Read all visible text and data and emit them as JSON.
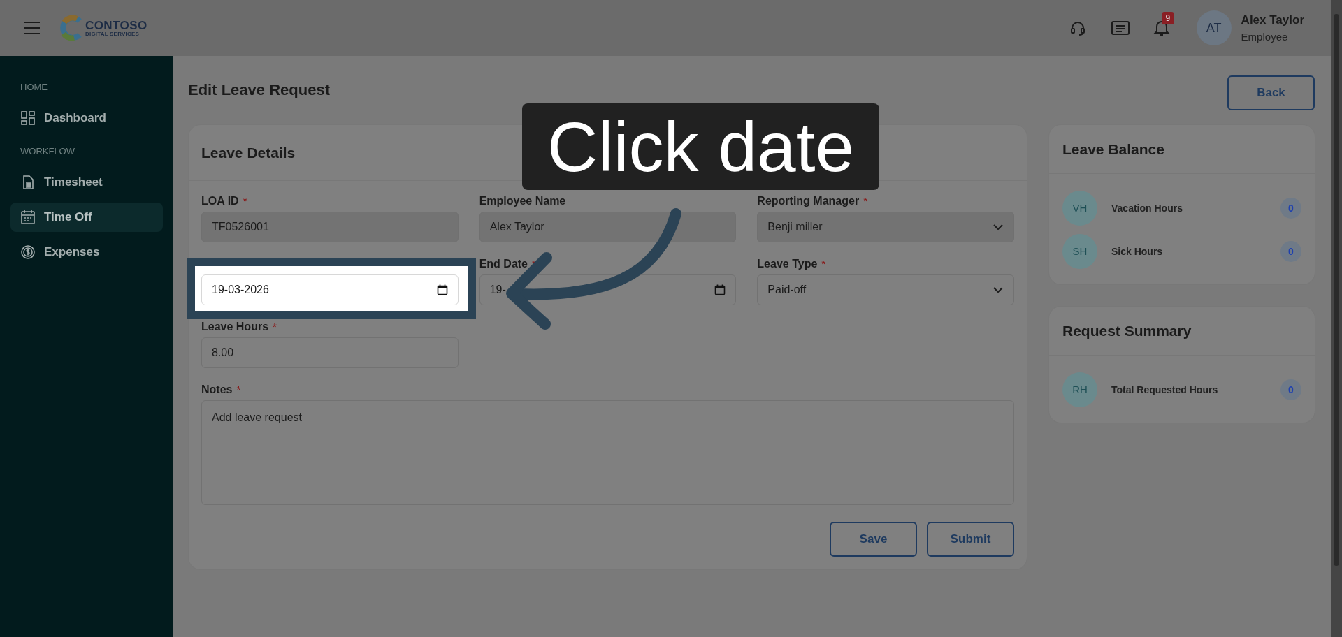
{
  "header": {
    "logo": {
      "name": "CONTOSO",
      "tagline": "DIGITAL SERVICES"
    },
    "notification_count": "9",
    "user": {
      "initials": "AT",
      "name": "Alex Taylor",
      "role": "Employee"
    }
  },
  "sidebar": {
    "sections": [
      {
        "heading": "HOME",
        "items": [
          {
            "label": "Dashboard",
            "kind": "dashboard",
            "selected": false
          }
        ]
      },
      {
        "heading": "WORKFLOW",
        "items": [
          {
            "label": "Timesheet",
            "kind": "timesheet",
            "selected": false
          },
          {
            "label": "Time Off",
            "kind": "calendar",
            "selected": true
          },
          {
            "label": "Expenses",
            "kind": "expenses",
            "selected": false
          }
        ]
      }
    ]
  },
  "page": {
    "title": "Edit Leave Request",
    "back_button": "Back"
  },
  "leave_details": {
    "title": "Leave Details",
    "fields": [
      {
        "kind": "text",
        "label": "LOA ID",
        "required_mark": "*",
        "value": "TF0526001",
        "disabled": true
      },
      {
        "kind": "text",
        "label": "Employee Name",
        "value": "Alex Taylor",
        "disabled": true
      },
      {
        "kind": "select",
        "label": "Reporting Manager",
        "required_mark": "*",
        "value": "Benji miller",
        "disabled": true
      },
      {
        "kind": "date",
        "value": "19-03-2026",
        "highlighted": true
      },
      {
        "kind": "date",
        "label": "End Date",
        "required_mark": "*",
        "value": "19-",
        "disabled": false
      },
      {
        "kind": "select",
        "label": "Leave Type",
        "required_mark": "*",
        "value": "Paid-off",
        "disabled": false
      },
      {
        "kind": "text",
        "label": "Leave Hours",
        "required_mark": "*",
        "value": "8.00",
        "disabled": false
      },
      {
        "kind": "textarea",
        "label": "Notes",
        "required_mark": "*",
        "value": "Add leave request",
        "disabled": false
      }
    ],
    "buttons": [
      "Save",
      "Submit"
    ]
  },
  "leave_balance": {
    "title": "Leave Balance",
    "items": [
      {
        "initials": "VH",
        "label": "Vacation Hours",
        "value": "0"
      },
      {
        "initials": "SH",
        "label": "Sick Hours",
        "value": "0"
      }
    ]
  },
  "request_summary": {
    "title": "Request Summary",
    "items": [
      {
        "initials": "RH",
        "label": "Total Requested Hours",
        "value": "0"
      }
    ]
  },
  "tutorial": {
    "caption": "Click date"
  }
}
